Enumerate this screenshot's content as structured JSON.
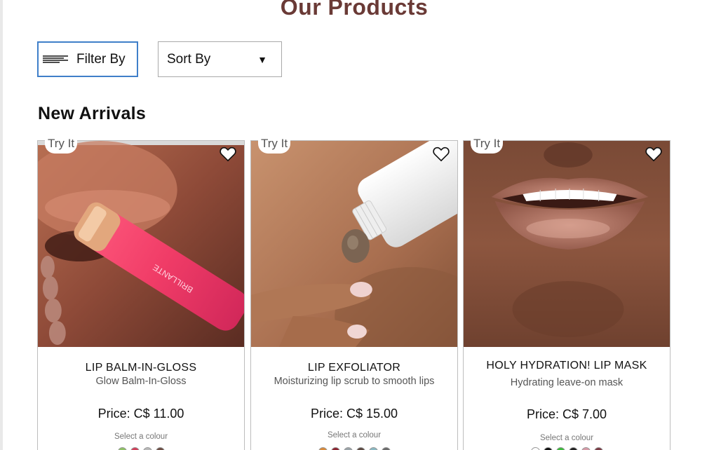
{
  "page": {
    "title": "Our Products"
  },
  "controls": {
    "filter_label": "Filter By",
    "sort_label": "Sort By"
  },
  "section": {
    "title": "New Arrivals"
  },
  "products": [
    {
      "tag": "Try It",
      "name": "LIP BALM-IN-GLOSS",
      "subtitle": "Glow Balm-In-Gloss",
      "price": "Price: C$ 11.00",
      "select_label": "Select a colour",
      "swatches": [
        "#8fc265",
        "#d2405a",
        "#b9b9b9",
        "#6d4e44"
      ]
    },
    {
      "tag": "Try It",
      "name": "LIP EXFOLIATOR",
      "subtitle": "Moisturizing lip scrub to smooth lips",
      "price": "Price: C$ 15.00",
      "select_label": "Select a colour",
      "swatches": [
        "#d98a3a",
        "#8c2430",
        "#9aa3a8",
        "#5d4b43",
        "#8ab8c2",
        "#6a6a6a"
      ]
    },
    {
      "tag": "Try It",
      "name": "HOLY HYDRATION! LIP MASK",
      "subtitle": "Hydrating leave-on mask",
      "price": "Price: C$ 7.00",
      "select_label": "Select a colour",
      "swatches": [
        "#ffffff",
        "#111111",
        "#3dbb3d",
        "#222222",
        "#d79aa7",
        "#7a3a44"
      ]
    }
  ]
}
